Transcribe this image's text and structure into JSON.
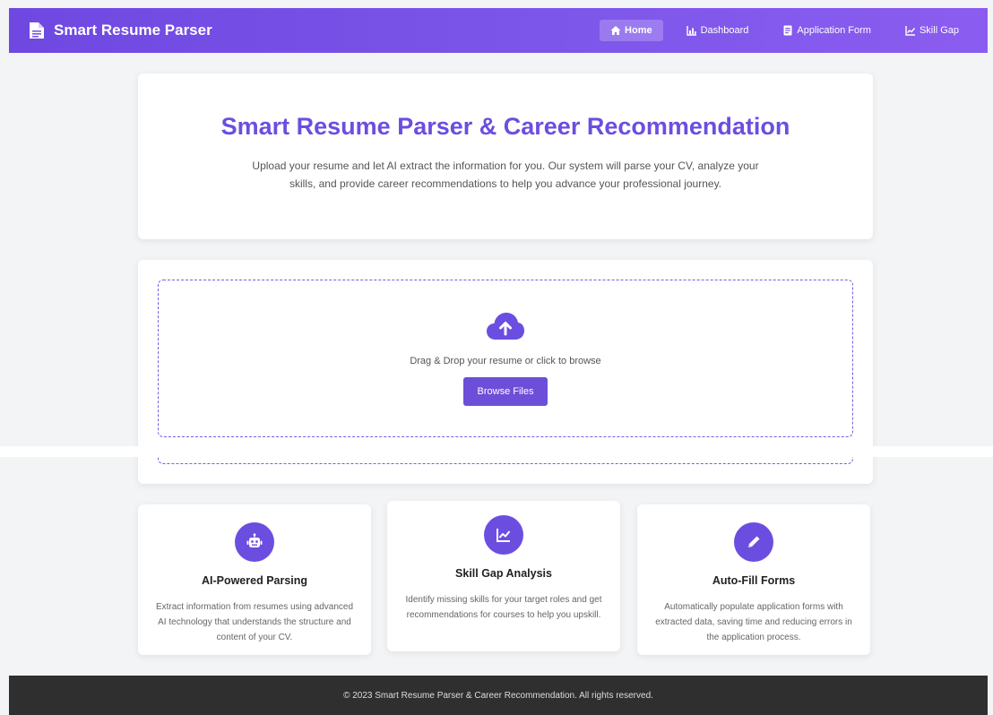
{
  "brand": {
    "title": "Smart Resume Parser",
    "icon": "document-icon"
  },
  "nav": {
    "items": [
      {
        "label": "Home",
        "icon": "home-icon",
        "active": true
      },
      {
        "label": "Dashboard",
        "icon": "chart-bar-icon",
        "active": false
      },
      {
        "label": "Application Form",
        "icon": "form-icon",
        "active": false
      },
      {
        "label": "Skill Gap",
        "icon": "chart-line-icon",
        "active": false
      }
    ]
  },
  "hero": {
    "title": "Smart Resume Parser & Career Recommendation",
    "description": "Upload your resume and let AI extract the information for you. Our system will parse your CV, analyze your skills, and provide career recommendations to help you advance your professional journey."
  },
  "upload": {
    "icon": "cloud-upload-icon",
    "prompt": "Drag & Drop your resume or click to browse",
    "button_label": "Browse Files"
  },
  "features": [
    {
      "icon": "robot-icon",
      "title": "AI-Powered Parsing",
      "description": "Extract information from resumes using advanced AI technology that understands the structure and content of your CV."
    },
    {
      "icon": "chart-line-icon",
      "title": "Skill Gap Analysis",
      "description": "Identify missing skills for your target roles and get recommendations for courses to help you upskill."
    },
    {
      "icon": "pencil-icon",
      "title": "Auto-Fill Forms",
      "description": "Automatically populate application forms with extracted data, saving time and reducing errors in the application process."
    }
  ],
  "footer": {
    "text": "© 2023 Smart Resume Parser & Career Recommendation. All rights reserved."
  },
  "colors": {
    "accent": "#6b4ee0",
    "footer_bg": "#2f2f2f",
    "page_bg": "#f3f4f6"
  }
}
